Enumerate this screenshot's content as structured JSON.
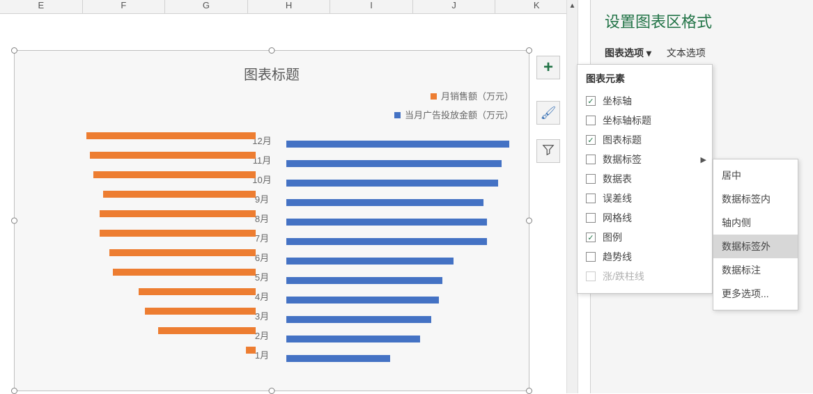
{
  "columns": [
    "E",
    "F",
    "G",
    "H",
    "I",
    "J",
    "K"
  ],
  "sidebar": {
    "title": "设置图表区格式",
    "tab1": "图表选项 ▾",
    "tab2": "文本选项"
  },
  "chart": {
    "title": "图表标题",
    "legend1": "月销售额（万元）",
    "legend2": "当月广告投放金额（万元）"
  },
  "chart_data": {
    "type": "bar",
    "categories": [
      "12月",
      "11月",
      "10月",
      "9月",
      "8月",
      "7月",
      "6月",
      "5月",
      "4月",
      "3月",
      "2月",
      "1月"
    ],
    "series": [
      {
        "name": "月销售额（万元）",
        "color": "#ed7d31",
        "values": [
          260,
          255,
          250,
          235,
          240,
          240,
          225,
          220,
          180,
          170,
          150,
          15
        ]
      },
      {
        "name": "当月广告投放金额（万元）",
        "color": "#4472c4",
        "values": [
          300,
          290,
          285,
          265,
          270,
          270,
          225,
          210,
          205,
          195,
          180,
          140
        ]
      }
    ],
    "xlabel": "",
    "ylabel": "",
    "title": "图表标题"
  },
  "elements_menu": {
    "title": "图表元素",
    "items": [
      {
        "label": "坐标轴",
        "checked": true
      },
      {
        "label": "坐标轴标题",
        "checked": false
      },
      {
        "label": "图表标题",
        "checked": true
      },
      {
        "label": "数据标签",
        "checked": false,
        "hasSub": true
      },
      {
        "label": "数据表",
        "checked": false
      },
      {
        "label": "误差线",
        "checked": false
      },
      {
        "label": "网格线",
        "checked": false
      },
      {
        "label": "图例",
        "checked": true
      },
      {
        "label": "趋势线",
        "checked": false
      },
      {
        "label": "涨/跌柱线",
        "checked": false,
        "disabled": true
      }
    ]
  },
  "submenu": {
    "items": [
      {
        "label": "居中"
      },
      {
        "label": "数据标签内"
      },
      {
        "label": "轴内侧"
      },
      {
        "label": "数据标签外",
        "active": true
      },
      {
        "label": "数据标注"
      },
      {
        "label": "更多选项..."
      }
    ]
  }
}
